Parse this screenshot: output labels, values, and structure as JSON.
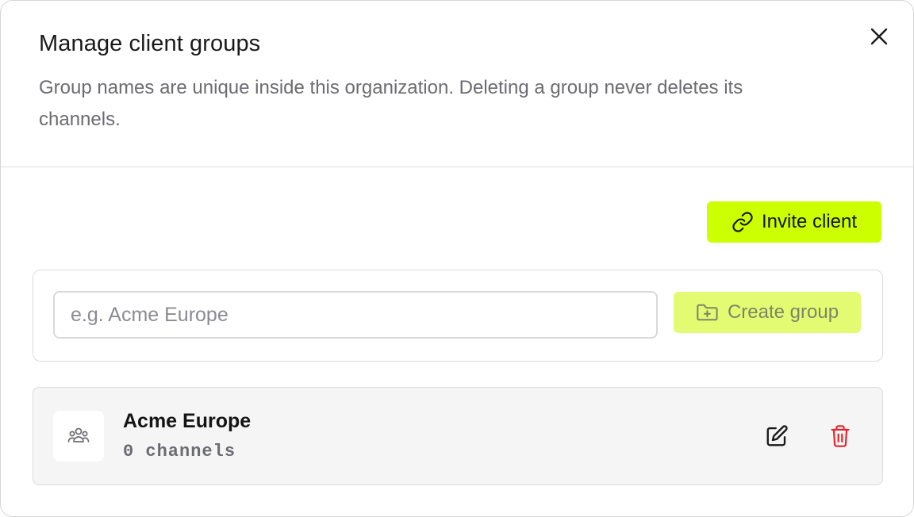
{
  "dialog": {
    "title": "Manage client groups",
    "description": "Group names are unique inside this organization. Deleting a group never deletes its channels.",
    "close_icon": "close-icon"
  },
  "toolbar": {
    "invite_label": "Invite client",
    "invite_icon": "link-icon",
    "invite_color": "#ccff00"
  },
  "create_form": {
    "input_value": "",
    "input_placeholder": "e.g. Acme Europe",
    "create_label": "Create group",
    "create_icon": "folder-plus-icon",
    "create_color_disabled": "#e3fb72"
  },
  "groups": [
    {
      "name": "Acme Europe",
      "channel_count": "0 channels",
      "icon": "users-icon",
      "edit_icon": "edit-icon",
      "delete_icon": "trash-icon",
      "delete_color": "#e5252a"
    }
  ]
}
